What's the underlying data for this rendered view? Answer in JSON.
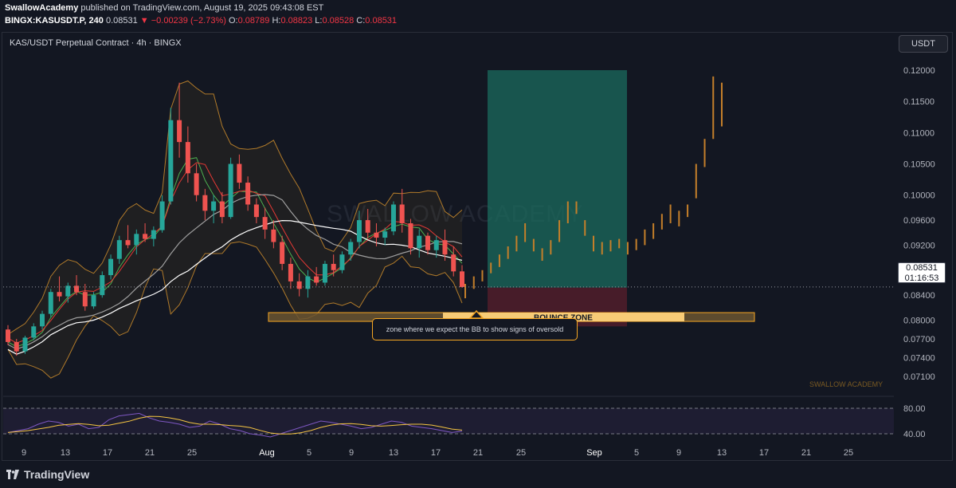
{
  "header": {
    "author": "SwallowAcademy",
    "published_text": " published on TradingView.com, August 19, 2025 09:43:08 EST",
    "symbol": "BINGX:KASUSDT.P, 240",
    "last": "0.08531",
    "change": "▼ −0.00239 (−2.73%)",
    "open_label": "O:",
    "open": "0.08789",
    "high_label": "H:",
    "high": "0.08823",
    "low_label": "L:",
    "low": "0.08528",
    "close_label": "C:",
    "close": "0.08531"
  },
  "chart_title": "KAS/USDT Perpetual Contract · 4h · BINGX",
  "currency_button": "USDT",
  "price_tag": {
    "price": "0.08531",
    "countdown": "01:16:53"
  },
  "annotations": {
    "bounce_zone": "BOUNCE ZONE",
    "callout": "zone where we expect the BB to show signs of oversold",
    "watermark": "SWALLOW ACADEMY",
    "center_watermark": "SWALLOW ACADEMY"
  },
  "footer": {
    "brand": "TradingView"
  },
  "colors": {
    "background": "#131722",
    "up": "#26a69a",
    "down": "#ef5350",
    "projection": "#c47f2a",
    "zone": "#f5a623",
    "target_box": "#1b6b5e",
    "stop_box": "#5a1f2c",
    "rsi": "#7e57c2"
  },
  "chart_data": [
    {
      "type": "candlestick",
      "title": "KAS/USDT Perpetual Contract · 4h · BINGX",
      "y_axis_ticks": [
        "0.12000",
        "0.11500",
        "0.11000",
        "0.10500",
        "0.10000",
        "0.09600",
        "0.09200",
        "0.08800",
        "0.08400",
        "0.08000",
        "0.07700",
        "0.07400",
        "0.07100"
      ],
      "x_axis_ticks": [
        "9",
        "13",
        "17",
        "21",
        "25",
        "Aug",
        "5",
        "9",
        "13",
        "17",
        "21",
        "25",
        "Sep",
        "5",
        "9",
        "13",
        "17",
        "21",
        "25"
      ],
      "series": [
        {
          "name": "KAS/USDT",
          "kind": "candles",
          "points": [
            [
              0.0785,
              0.0792,
              0.076,
              0.0765
            ],
            [
              0.0765,
              0.077,
              0.0743,
              0.075
            ],
            [
              0.075,
              0.0775,
              0.0746,
              0.0772
            ],
            [
              0.0772,
              0.0795,
              0.0768,
              0.079
            ],
            [
              0.079,
              0.0815,
              0.0785,
              0.081
            ],
            [
              0.081,
              0.085,
              0.0805,
              0.0845
            ],
            [
              0.0845,
              0.087,
              0.083,
              0.0838
            ],
            [
              0.0838,
              0.086,
              0.0828,
              0.0855
            ],
            [
              0.0855,
              0.0872,
              0.084,
              0.0845
            ],
            [
              0.0845,
              0.0858,
              0.0815,
              0.0822
            ],
            [
              0.0822,
              0.0845,
              0.0818,
              0.084
            ],
            [
              0.084,
              0.0878,
              0.0836,
              0.0872
            ],
            [
              0.0872,
              0.0905,
              0.0865,
              0.0898
            ],
            [
              0.0898,
              0.0935,
              0.089,
              0.0928
            ],
            [
              0.0928,
              0.0952,
              0.0915,
              0.092
            ],
            [
              0.092,
              0.0945,
              0.0905,
              0.0938
            ],
            [
              0.0938,
              0.0955,
              0.0925,
              0.093
            ],
            [
              0.093,
              0.095,
              0.0918,
              0.0944
            ],
            [
              0.0944,
              0.1,
              0.094,
              0.099
            ],
            [
              0.099,
              0.114,
              0.0985,
              0.112
            ],
            [
              0.112,
              0.118,
              0.106,
              0.1085
            ],
            [
              0.1085,
              0.111,
              0.102,
              0.1035
            ],
            [
              0.1035,
              0.105,
              0.099,
              0.1
            ],
            [
              0.1,
              0.101,
              0.096,
              0.0975
            ],
            [
              0.0975,
              0.1,
              0.0955,
              0.099
            ],
            [
              0.099,
              0.1005,
              0.0955,
              0.0965
            ],
            [
              0.0965,
              0.106,
              0.0962,
              0.105
            ],
            [
              0.105,
              0.1065,
              0.101,
              0.102
            ],
            [
              0.102,
              0.103,
              0.0975,
              0.0985
            ],
            [
              0.0985,
              0.0995,
              0.0955,
              0.0965
            ],
            [
              0.0965,
              0.098,
              0.093,
              0.0945
            ],
            [
              0.0945,
              0.096,
              0.0915,
              0.0925
            ],
            [
              0.0925,
              0.0935,
              0.088,
              0.089
            ],
            [
              0.089,
              0.09,
              0.085,
              0.0862
            ],
            [
              0.0862,
              0.0875,
              0.0838,
              0.085
            ],
            [
              0.085,
              0.088,
              0.0836,
              0.087
            ],
            [
              0.087,
              0.0885,
              0.0855,
              0.086
            ],
            [
              0.086,
              0.0895,
              0.0855,
              0.089
            ],
            [
              0.089,
              0.0905,
              0.087,
              0.088
            ],
            [
              0.088,
              0.091,
              0.0875,
              0.0905
            ],
            [
              0.0905,
              0.093,
              0.0895,
              0.0925
            ],
            [
              0.0925,
              0.0975,
              0.0915,
              0.096
            ],
            [
              0.096,
              0.0978,
              0.093,
              0.094
            ],
            [
              0.094,
              0.0955,
              0.0918,
              0.0932
            ],
            [
              0.0932,
              0.0948,
              0.092,
              0.0942
            ],
            [
              0.0942,
              0.099,
              0.0936,
              0.0985
            ],
            [
              0.0985,
              0.101,
              0.094,
              0.0955
            ],
            [
              0.0955,
              0.0962,
              0.0905,
              0.0915
            ],
            [
              0.0915,
              0.0945,
              0.09,
              0.0935
            ],
            [
              0.0935,
              0.094,
              0.0905,
              0.0912
            ],
            [
              0.0912,
              0.0935,
              0.09,
              0.0928
            ],
            [
              0.0928,
              0.0945,
              0.0895,
              0.0905
            ],
            [
              0.0905,
              0.0918,
              0.087,
              0.0878
            ],
            [
              0.0878,
              0.0888,
              0.0852,
              0.0853
            ]
          ]
        },
        {
          "name": "Projection",
          "kind": "projected_path",
          "points": [
            [
              0.0835,
              0.0858
            ],
            [
              0.085,
              0.087
            ],
            [
              0.0862,
              0.088
            ],
            [
              0.0875,
              0.0892
            ],
            [
              0.0885,
              0.0905
            ],
            [
              0.0898,
              0.0918
            ],
            [
              0.091,
              0.0935
            ],
            [
              0.0925,
              0.0955
            ],
            [
              0.091,
              0.093
            ],
            [
              0.0895,
              0.0915
            ],
            [
              0.0905,
              0.0928
            ],
            [
              0.0925,
              0.096
            ],
            [
              0.0955,
              0.099
            ],
            [
              0.097,
              0.099
            ],
            [
              0.0935,
              0.096
            ],
            [
              0.091,
              0.0935
            ],
            [
              0.0905,
              0.0925
            ],
            [
              0.091,
              0.0928
            ],
            [
              0.0915,
              0.093
            ],
            [
              0.0905,
              0.0925
            ],
            [
              0.0912,
              0.093
            ],
            [
              0.092,
              0.0945
            ],
            [
              0.093,
              0.0955
            ],
            [
              0.0945,
              0.097
            ],
            [
              0.0955,
              0.0985
            ],
            [
              0.095,
              0.0975
            ],
            [
              0.0965,
              0.0985
            ],
            [
              0.0995,
              0.105
            ],
            [
              0.1045,
              0.109
            ],
            [
              0.109,
              0.119
            ],
            [
              0.111,
              0.118
            ]
          ]
        }
      ],
      "bounce_zone": {
        "label": "BOUNCE ZONE",
        "low": 0.0798,
        "high": 0.0812
      },
      "target_box": {
        "low": 0.0852,
        "high": 0.12
      },
      "stop_box": {
        "low": 0.079,
        "high": 0.0852
      },
      "last_price": 0.08531
    },
    {
      "type": "line",
      "title": "RSI",
      "y_axis_ticks": [
        "80.00",
        "40.00"
      ],
      "series": [
        {
          "values": [
            42,
            45,
            48,
            55,
            60,
            58,
            52,
            55,
            48,
            50,
            62,
            68,
            70,
            72,
            65,
            60,
            58,
            55,
            50,
            52,
            60,
            55,
            48,
            45,
            40,
            38,
            35,
            40,
            45,
            50,
            55,
            60,
            58,
            55,
            52,
            48,
            50,
            55,
            60,
            58,
            52,
            50,
            48,
            45,
            42,
            44
          ]
        }
      ]
    }
  ]
}
